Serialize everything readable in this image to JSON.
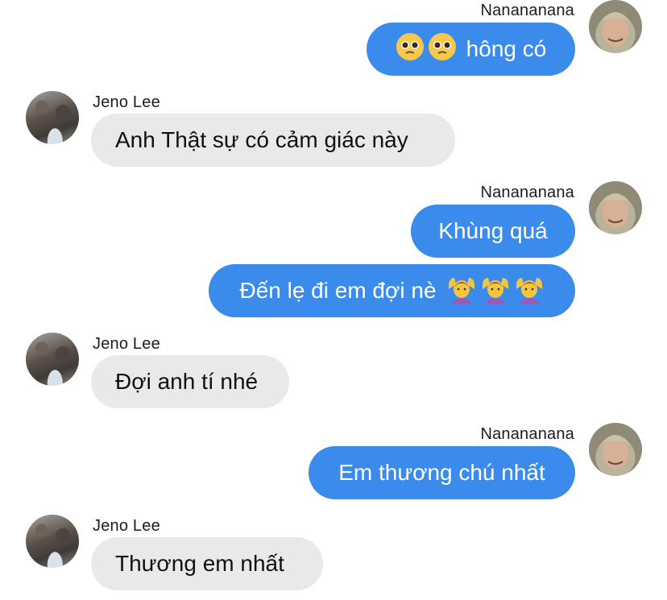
{
  "messages": [
    {
      "side": "out",
      "sender": "Nanananana",
      "text": "hông có",
      "leading_emojis": [
        "pleading-face",
        "pleading-face"
      ]
    },
    {
      "side": "in",
      "sender": "Jeno Lee",
      "text": "Anh Thật sự có cảm giác này"
    },
    {
      "side": "out",
      "sender": "Nanananana",
      "text": "Khùng quá"
    },
    {
      "side": "out",
      "sender": "",
      "text": "Đến lẹ đi em đợi nè",
      "trailing_emojis": [
        "person-gesturing-ok",
        "person-gesturing-ok",
        "person-gesturing-ok"
      ]
    },
    {
      "side": "in",
      "sender": "Jeno Lee",
      "text": "Đợi anh tí nhé"
    },
    {
      "side": "out",
      "sender": "Nanananana",
      "text": "Em thương chú nhất"
    },
    {
      "side": "in",
      "sender": "Jeno Lee",
      "text": "Thương em nhất"
    }
  ],
  "colors": {
    "outgoing_bubble": "#3b8bed",
    "incoming_bubble": "#e9e9eb"
  }
}
